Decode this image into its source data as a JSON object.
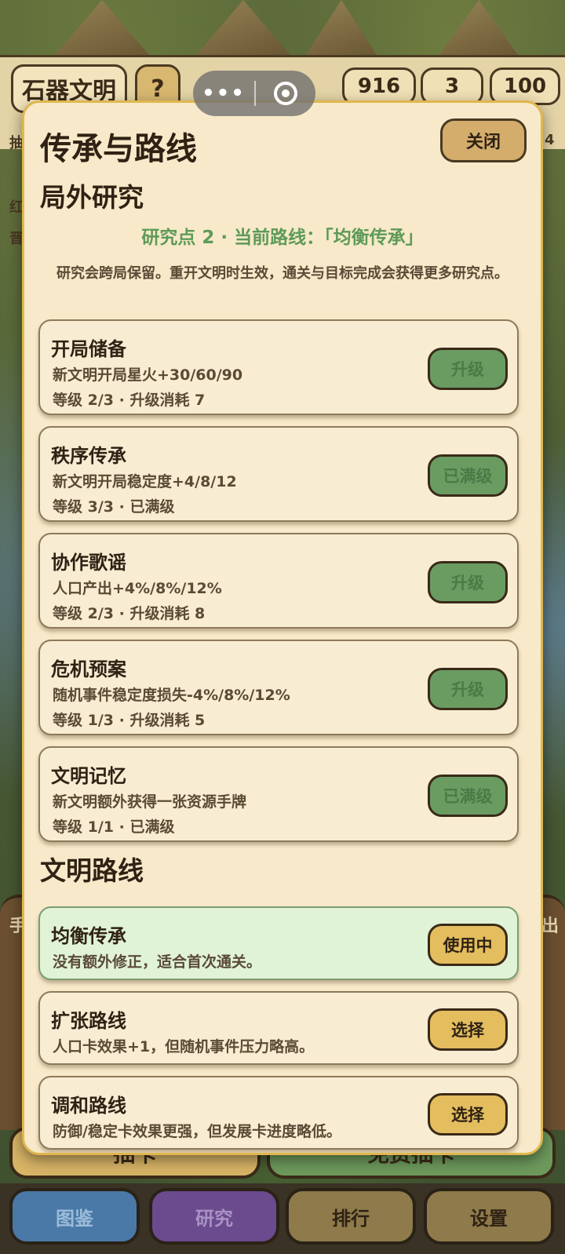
{
  "background": {
    "civ_name": "石器文明",
    "help_label": "?",
    "stats": [
      "916",
      "3",
      "100"
    ],
    "peek_left": [
      "抽",
      "红",
      "晋"
    ],
    "peek_right": "4",
    "hand_label": "手",
    "hand_right": "出",
    "draw_button": "抽卡",
    "free_draw_button": "免费抽卡"
  },
  "bottom_nav": {
    "items": [
      "图鉴",
      "研究",
      "排行",
      "设置"
    ]
  },
  "capsule": {
    "menu_dots": "•••"
  },
  "modal": {
    "title": "传承与路线",
    "close_label": "关闭",
    "research_title": "局外研究",
    "points_line": "研究点 2 · 当前路线：「均衡传承」",
    "note": "研究会跨局保留。重开文明时生效，通关与目标完成会获得更多研究点。",
    "research_items": [
      {
        "name": "开局储备",
        "desc": "新文明开局星火+30/60/90",
        "meta": "等级 2/3 · 升级消耗 7",
        "button": "升级"
      },
      {
        "name": "秩序传承",
        "desc": "新文明开局稳定度+4/8/12",
        "meta": "等级 3/3 · 已满级",
        "button": "已满级"
      },
      {
        "name": "协作歌谣",
        "desc": "人口产出+4%/8%/12%",
        "meta": "等级 2/3 · 升级消耗 8",
        "button": "升级"
      },
      {
        "name": "危机预案",
        "desc": "随机事件稳定度损失-4%/8%/12%",
        "meta": "等级 1/3 · 升级消耗 5",
        "button": "升级"
      },
      {
        "name": "文明记忆",
        "desc": "新文明额外获得一张资源手牌",
        "meta": "等级 1/1 · 已满级",
        "button": "已满级"
      }
    ],
    "route_title": "文明路线",
    "routes": [
      {
        "name": "均衡传承",
        "desc": "没有额外修正，适合首次通关。",
        "button": "使用中"
      },
      {
        "name": "扩张路线",
        "desc": "人口卡效果+1，但随机事件压力略高。",
        "button": "选择"
      },
      {
        "name": "调和路线",
        "desc": "防御/稳定卡效果更强，但发展卡进度略低。",
        "button": "选择"
      }
    ]
  },
  "colors": {
    "modal_bg": "#f7e9c9",
    "accent_green": "#5e9a58",
    "button_gold": "#e4bd5f",
    "active_route_bg": "#e0f3d7"
  }
}
